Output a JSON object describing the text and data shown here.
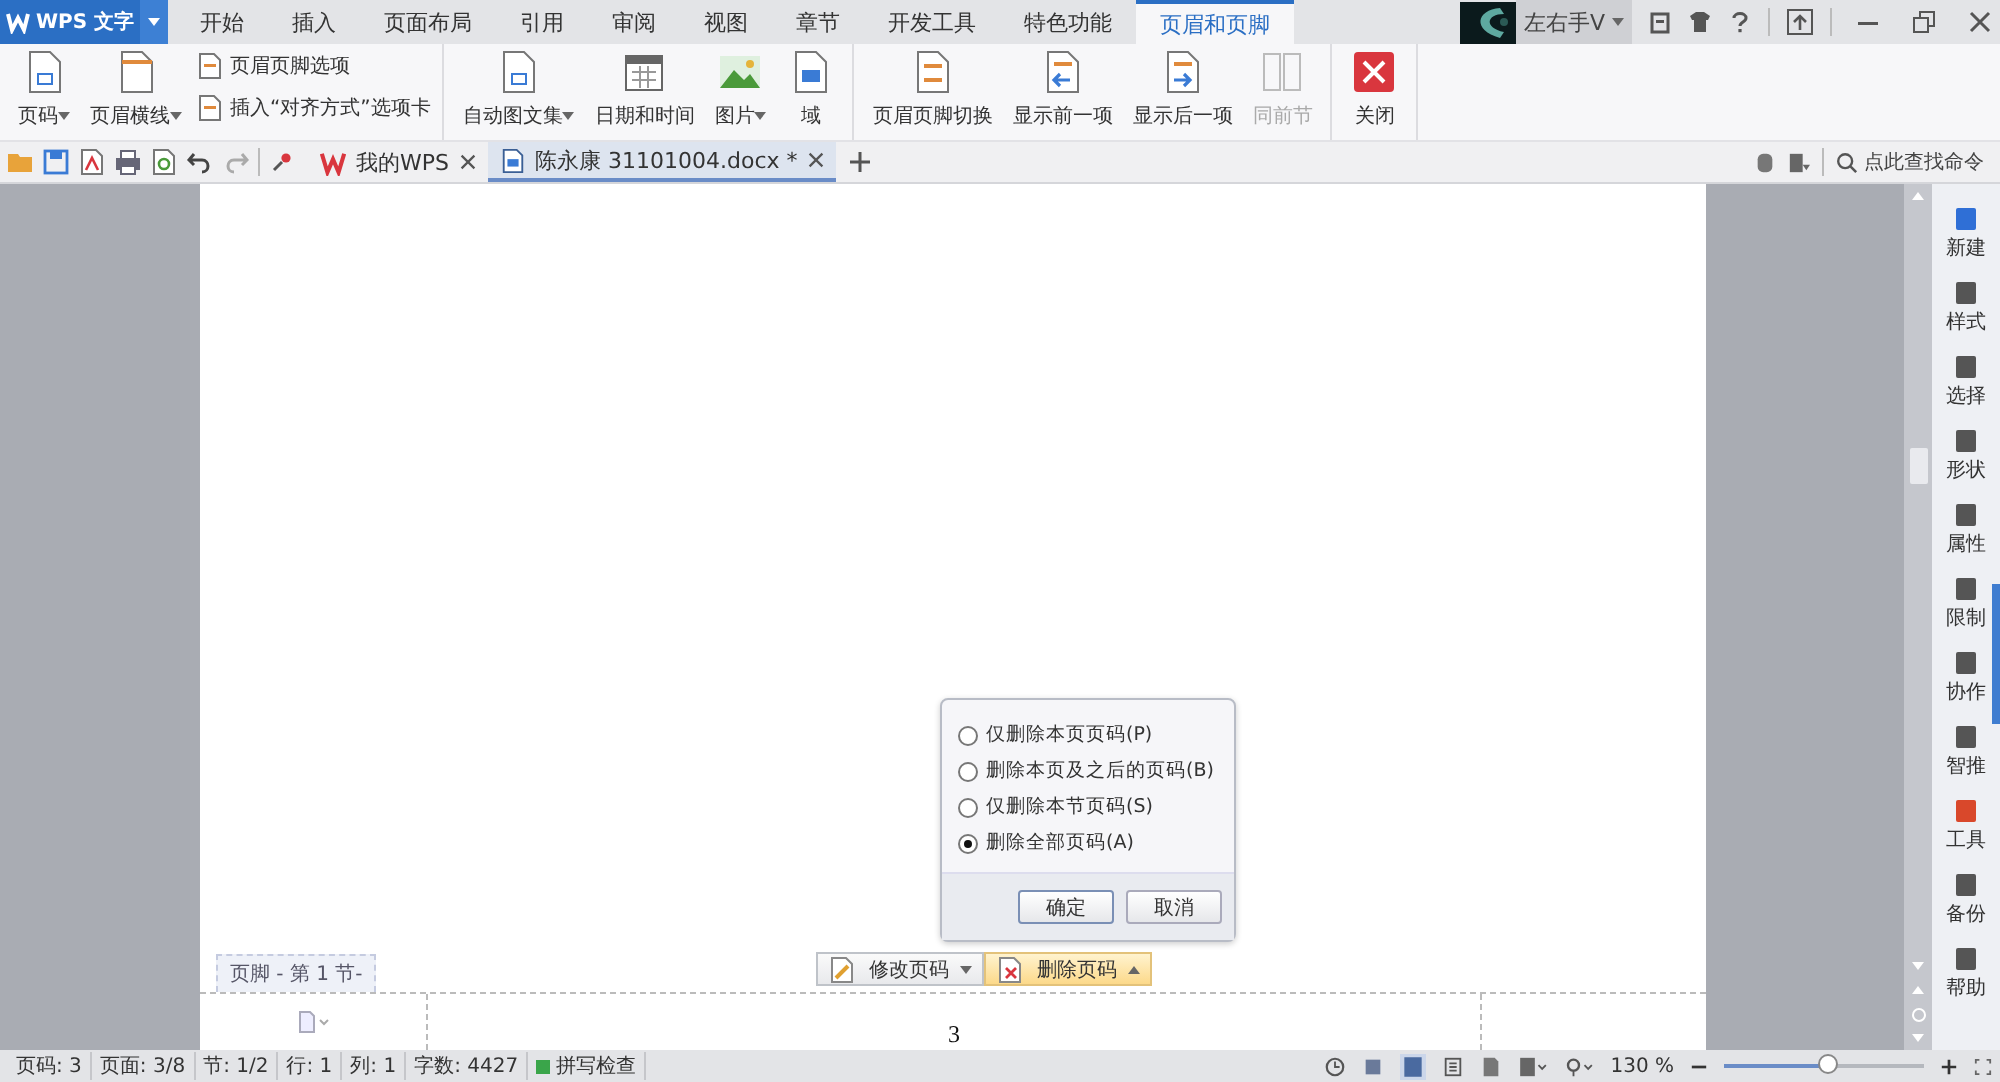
{
  "app_button": {
    "label": "WPS 文字"
  },
  "menu_tabs": [
    {
      "label": "开始",
      "selected": false
    },
    {
      "label": "插入",
      "selected": false
    },
    {
      "label": "页面布局",
      "selected": false
    },
    {
      "label": "引用",
      "selected": false
    },
    {
      "label": "审阅",
      "selected": false
    },
    {
      "label": "视图",
      "selected": false
    },
    {
      "label": "章节",
      "selected": false
    },
    {
      "label": "开发工具",
      "selected": false
    },
    {
      "label": "特色功能",
      "selected": false
    },
    {
      "label": "页眉和页脚",
      "selected": true
    }
  ],
  "user": {
    "name": "左右手V"
  },
  "ribbon_groups": [
    {
      "items": [
        {
          "label": "页码",
          "kind": "large",
          "dropdown": true,
          "disabled": false
        },
        {
          "label": "页眉横线",
          "kind": "large",
          "dropdown": true,
          "disabled": false
        },
        {
          "label": "页眉页脚选项",
          "kind": "small",
          "dropdown": false,
          "disabled": false
        },
        {
          "label": "插入“对齐方式”选项卡",
          "kind": "small",
          "dropdown": false,
          "disabled": false
        }
      ]
    },
    {
      "items": [
        {
          "label": "自动图文集",
          "kind": "large",
          "dropdown": true,
          "disabled": false
        },
        {
          "label": "日期和时间",
          "kind": "large",
          "dropdown": false,
          "disabled": false
        },
        {
          "label": "图片",
          "kind": "large",
          "dropdown": true,
          "disabled": false
        },
        {
          "label": "域",
          "kind": "large",
          "dropdown": false,
          "disabled": false
        }
      ]
    },
    {
      "items": [
        {
          "label": "页眉页脚切换",
          "kind": "large",
          "dropdown": false,
          "disabled": false
        },
        {
          "label": "显示前一项",
          "kind": "large",
          "dropdown": false,
          "disabled": false
        },
        {
          "label": "显示后一项",
          "kind": "large",
          "dropdown": false,
          "disabled": false
        },
        {
          "label": "同前节",
          "kind": "large",
          "dropdown": false,
          "disabled": true
        }
      ]
    },
    {
      "items": [
        {
          "label": "关闭",
          "kind": "large",
          "dropdown": false,
          "disabled": false
        }
      ]
    }
  ],
  "doc_tabs": [
    {
      "label": "我的WPS",
      "selected": false
    },
    {
      "label": "陈永康 31101004.docx *",
      "selected": true
    }
  ],
  "command_search": {
    "placeholder": "点此查找命令"
  },
  "document": {
    "footer_label": "页脚  - 第 1 节-",
    "footer_buttons": [
      {
        "label": "修改页码",
        "selected": false
      },
      {
        "label": "删除页码",
        "selected": true
      }
    ],
    "page_number": "3"
  },
  "delete_dialog": {
    "options": [
      {
        "label": "仅删除本页页码(P)",
        "selected": false
      },
      {
        "label": "删除本页及之后的页码(B)",
        "selected": false
      },
      {
        "label": "仅删除本节页码(S)",
        "selected": false
      },
      {
        "label": "删除全部页码(A)",
        "selected": true
      }
    ],
    "buttons": [
      "确定",
      "取消"
    ]
  },
  "side_panel": [
    "新建",
    "样式",
    "选择",
    "形状",
    "属性",
    "限制",
    "协作",
    "智推",
    "工具",
    "备份",
    "帮助"
  ],
  "status_bar": {
    "items": [
      "页码: 3",
      "页面: 3/8",
      "节: 1/2",
      "行: 1",
      "列: 1",
      "字数: 4427"
    ],
    "spell_check": "拼写检查",
    "zoom": "130 %",
    "zoom_slider": {
      "level": 0.52
    }
  }
}
